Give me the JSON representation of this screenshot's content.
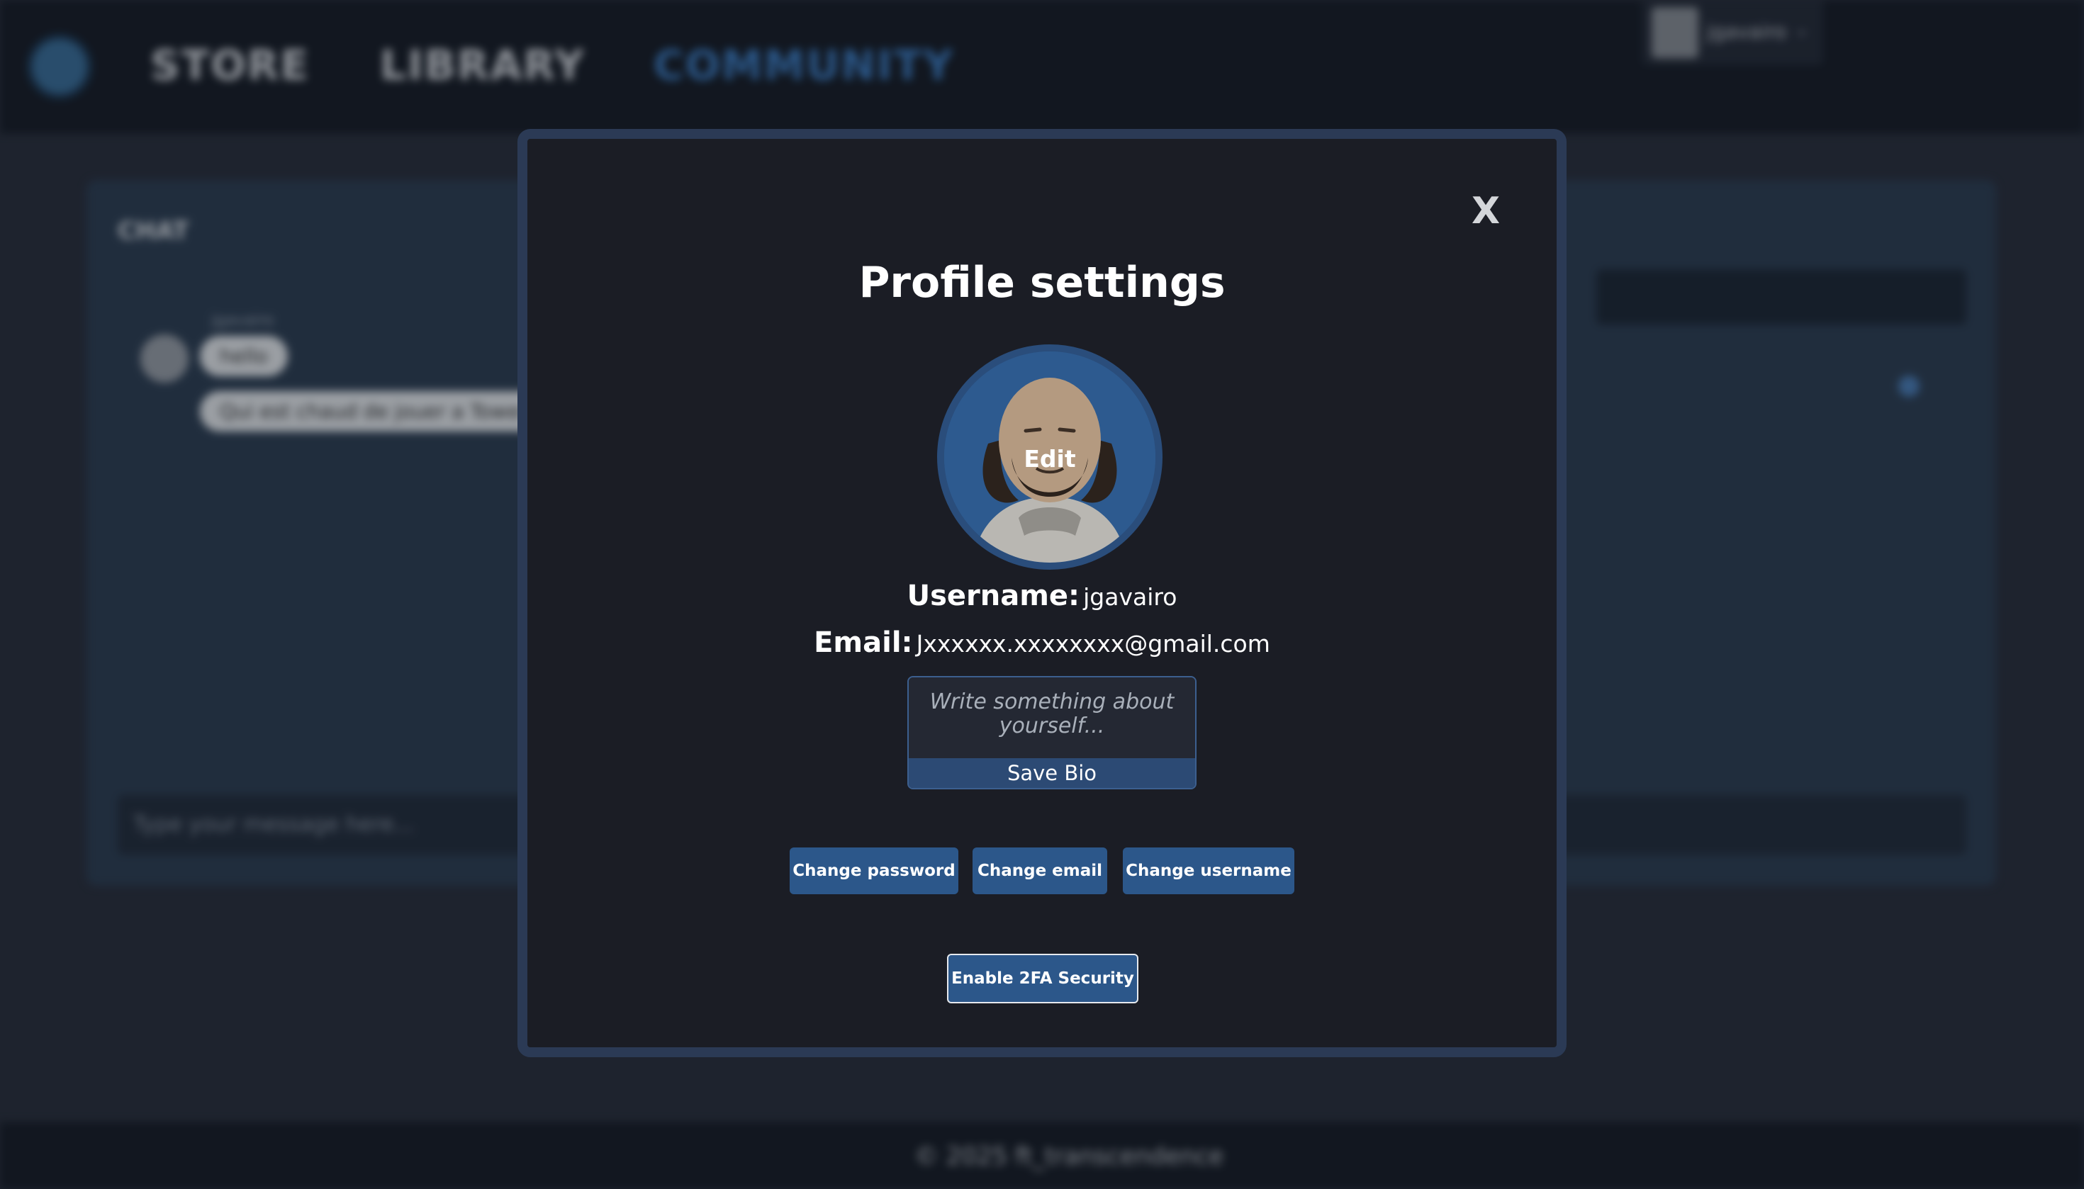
{
  "nav": {
    "store": "STORE",
    "library": "LIBRARY",
    "community": "COMMUNITY",
    "user": "jgavairo"
  },
  "chat": {
    "title": "CHAT",
    "sender": "jgavairo",
    "messages": [
      "hello",
      "Qui est chaud de jouer a Tower"
    ],
    "input_placeholder": "Type your message here..."
  },
  "footer": {
    "text": "© 2025 ft_transcendence"
  },
  "modal": {
    "close_label": "X",
    "title": "Profile settings",
    "avatar_edit_label": "Edit",
    "username_label": "Username:",
    "username_value": "jgavairo",
    "email_label": "Email:",
    "email_value": "Jxxxxxx.xxxxxxxx@gmail.com",
    "bio_placeholder": "Write something about yourself...",
    "save_bio_label": "Save Bio",
    "buttons": {
      "change_password": "Change password",
      "change_email": "Change email",
      "change_username": "Change username"
    },
    "enable_2fa_label": "Enable 2FA Security"
  },
  "colors": {
    "accent": "#2c578a",
    "community_active": "#3e7ec4",
    "modal_bg": "#1b1d25"
  }
}
